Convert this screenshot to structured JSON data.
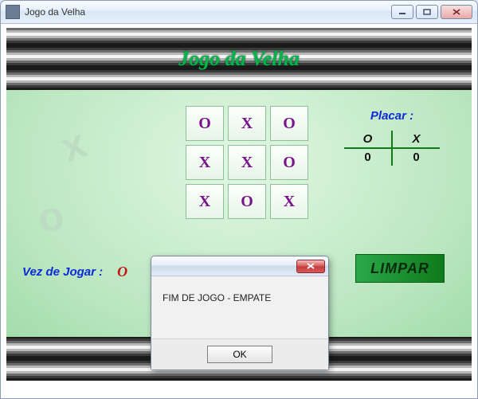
{
  "window": {
    "title": "Jogo da Velha"
  },
  "heading": "Jogo da Velha",
  "board": {
    "cells": [
      "O",
      "X",
      "O",
      "X",
      "X",
      "O",
      "X",
      "O",
      "X"
    ]
  },
  "score": {
    "title": "Placar :",
    "col_o": "O",
    "col_x": "X",
    "val_o": "0",
    "val_x": "0"
  },
  "turn": {
    "label": "Vez de Jogar :",
    "mark": "O"
  },
  "buttons": {
    "clear": "LIMPAR"
  },
  "dialog": {
    "message": "FIM DE JOGO - EMPATE",
    "ok": "OK"
  }
}
